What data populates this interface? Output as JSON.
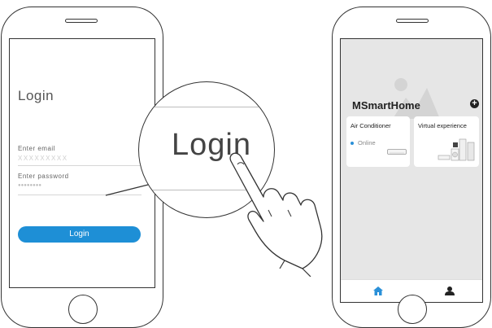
{
  "login_screen": {
    "title": "Login",
    "email_label": "Enter email",
    "email_value": "XXXXXXXXX",
    "password_label": "Enter password",
    "password_value": "●●●●●●●●",
    "login_button": "Login",
    "button_color": "#1e8fd6"
  },
  "magnifier": {
    "text": "Login"
  },
  "home_screen": {
    "app_title": "MSmartHome",
    "add_icon": "plus-circle-icon",
    "cards": [
      {
        "title": "Air Conditioner",
        "status": "Online"
      },
      {
        "title": "Virtual experience"
      }
    ],
    "tabs": [
      {
        "icon": "home-icon",
        "color": "#2a90d8"
      },
      {
        "icon": "person-icon",
        "color": "#222222"
      }
    ],
    "background_color": "#e6e6e6"
  }
}
